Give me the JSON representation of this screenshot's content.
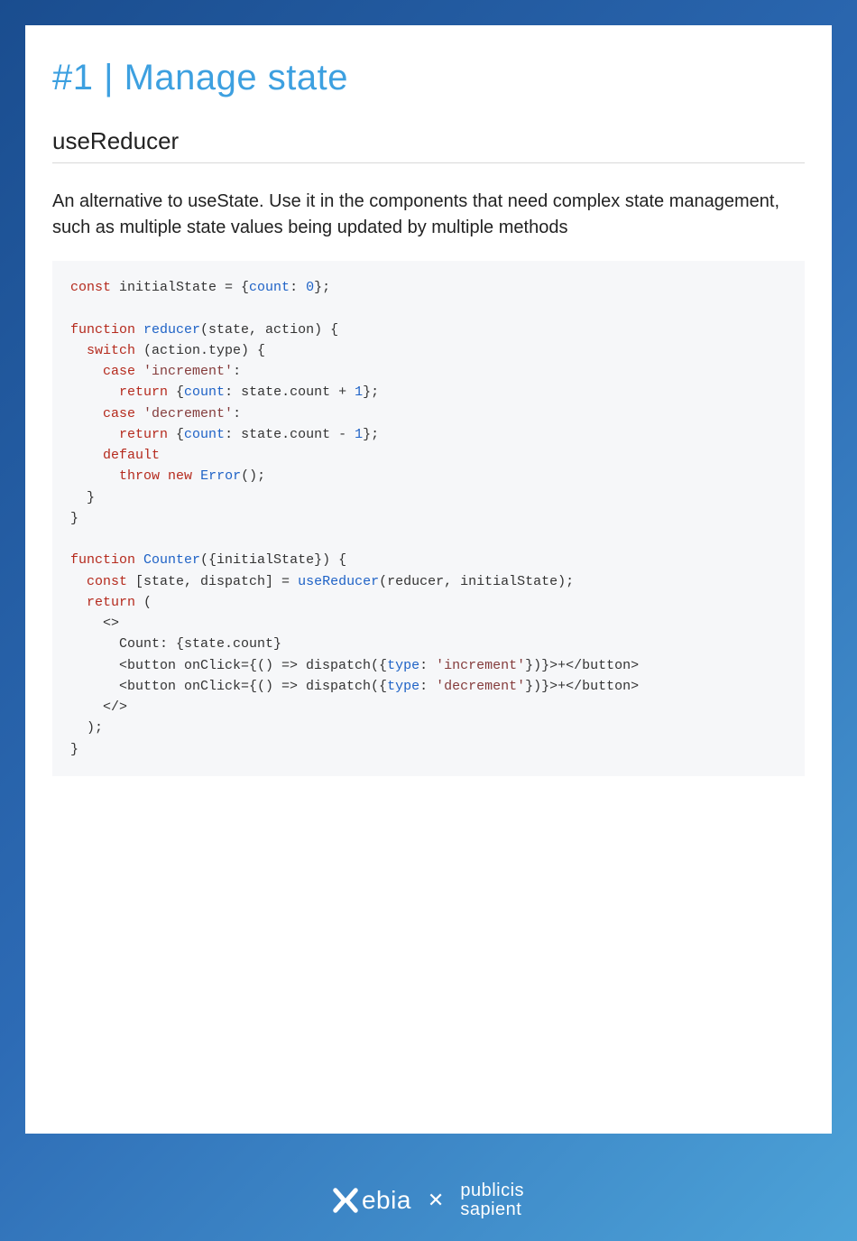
{
  "title": "#1 | Manage state",
  "section_heading": "useReducer",
  "body_text": "An alternative to useState. Use it in the components that need complex state management, such as multiple state values being updated by multiple methods",
  "code": {
    "l01a": "const",
    "l01b": " initialState = {",
    "l01c": "count",
    "l01d": ": ",
    "l01e": "0",
    "l01f": "};",
    "l02": "",
    "l03a": "function",
    "l03b": " ",
    "l03c": "reducer",
    "l03d": "(state, action) {",
    "l04a": "  ",
    "l04b": "switch",
    "l04c": " (action.type) {",
    "l05a": "    ",
    "l05b": "case",
    "l05c": " ",
    "l05d": "'increment'",
    "l05e": ":",
    "l06a": "      ",
    "l06b": "return",
    "l06c": " {",
    "l06d": "count",
    "l06e": ": state.count + ",
    "l06f": "1",
    "l06g": "};",
    "l07a": "    ",
    "l07b": "case",
    "l07c": " ",
    "l07d": "'decrement'",
    "l07e": ":",
    "l08a": "      ",
    "l08b": "return",
    "l08c": " {",
    "l08d": "count",
    "l08e": ": state.count - ",
    "l08f": "1",
    "l08g": "};",
    "l09a": "    ",
    "l09b": "default",
    "l10a": "      ",
    "l10b": "throw",
    "l10c": " ",
    "l10d": "new",
    "l10e": " ",
    "l10f": "Error",
    "l10g": "();",
    "l11": "  }",
    "l12": "}",
    "l13": "",
    "l14a": "function",
    "l14b": " ",
    "l14c": "Counter",
    "l14d": "({initialState}) {",
    "l15a": "  ",
    "l15b": "const",
    "l15c": " [state, dispatch] = ",
    "l15d": "useReducer",
    "l15e": "(reducer, initialState);",
    "l16a": "  ",
    "l16b": "return",
    "l16c": " (",
    "l17": "    <>",
    "l18": "      Count: {state.count}",
    "l19a": "      <button onClick={() => dispatch({",
    "l19b": "type",
    "l19c": ": ",
    "l19d": "'increment'",
    "l19e": "})}>+</button>",
    "l20a": "      <button onClick={() => dispatch({",
    "l20b": "type",
    "l20c": ": ",
    "l20d": "'decrement'",
    "l20e": "})}>+</button>",
    "l21": "    </>",
    "l22": "  );",
    "l23": "}"
  },
  "footer": {
    "xebia": "ebia",
    "sep": "✕",
    "ps_line1": "publicis",
    "ps_line2": "sapient"
  }
}
